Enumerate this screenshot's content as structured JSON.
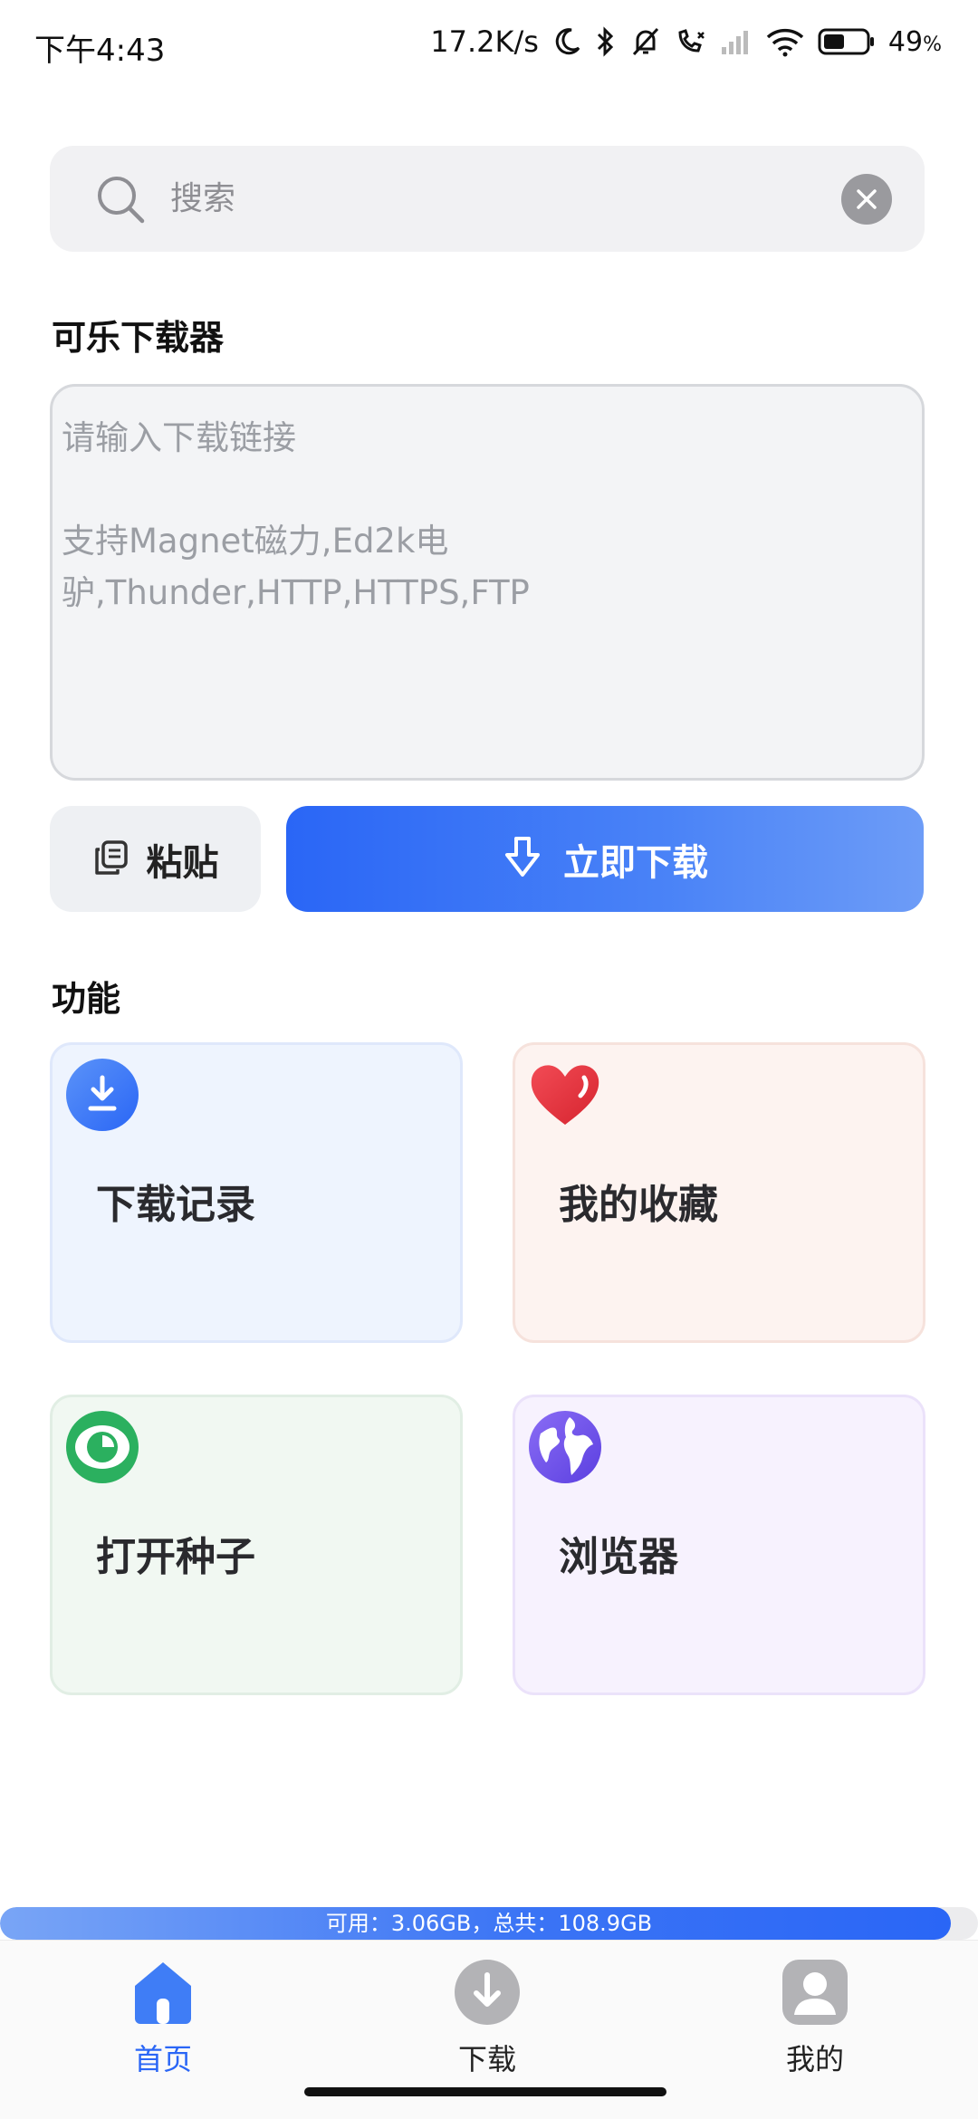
{
  "status_bar": {
    "time": "下午4:43",
    "net_speed": "17.2K/s",
    "battery_pct": "49",
    "battery_unit": "%",
    "icons": [
      "moon-icon",
      "bluetooth-icon",
      "mute-icon",
      "call-icon",
      "signal-icon",
      "wifi-icon",
      "battery-icon"
    ]
  },
  "search": {
    "placeholder": "搜索"
  },
  "downloader": {
    "section_title": "可乐下载器",
    "input_placeholder_line1": "请输入下载链接",
    "input_placeholder_line2": "支持Magnet磁力,Ed2k电驴,Thunder,HTTP,HTTPS,FTP",
    "paste_label": "粘贴",
    "download_label": "立即下载"
  },
  "features": {
    "section_title": "功能",
    "items": [
      {
        "label": "下载记录",
        "icon": "download-circle-icon",
        "accent": "#3f7df6"
      },
      {
        "label": "我的收藏",
        "icon": "heart-icon",
        "accent": "#e8353f"
      },
      {
        "label": "打开种子",
        "icon": "eye-icon",
        "accent": "#2bb05f"
      },
      {
        "label": "浏览器",
        "icon": "globe-icon",
        "accent": "#7a5cf0"
      }
    ]
  },
  "storage": {
    "text": "可用：3.06GB，总共：108.9GB",
    "used_fraction": 0.972
  },
  "bottom_nav": {
    "items": [
      {
        "label": "首页",
        "icon": "home-icon",
        "active": true
      },
      {
        "label": "下载",
        "icon": "download-icon",
        "active": false
      },
      {
        "label": "我的",
        "icon": "profile-icon",
        "active": false
      }
    ]
  },
  "colors": {
    "primary": "#2a66f6",
    "inactive_icon": "#b3b3b6"
  }
}
